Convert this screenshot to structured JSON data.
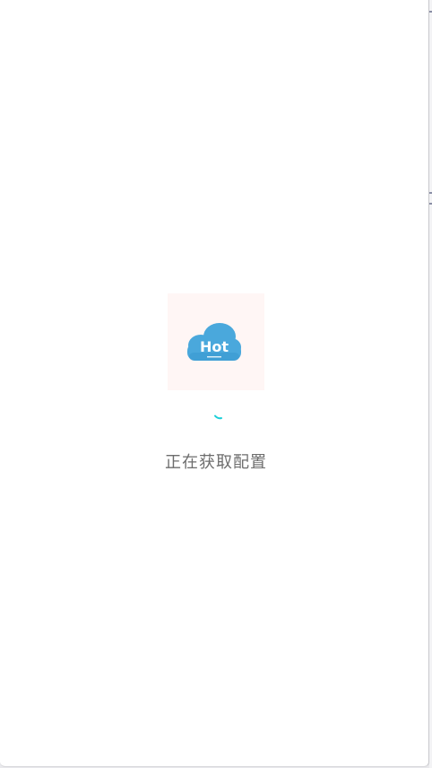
{
  "splash": {
    "logo": {
      "icon": "cloud-icon",
      "text": "Hot",
      "cloud_color": "#4aa8dc",
      "background_color": "#fff6f5"
    },
    "spinner": {
      "icon": "loading-spinner-icon",
      "color": "#1ccfd8"
    },
    "status_text": "正在获取配置"
  }
}
